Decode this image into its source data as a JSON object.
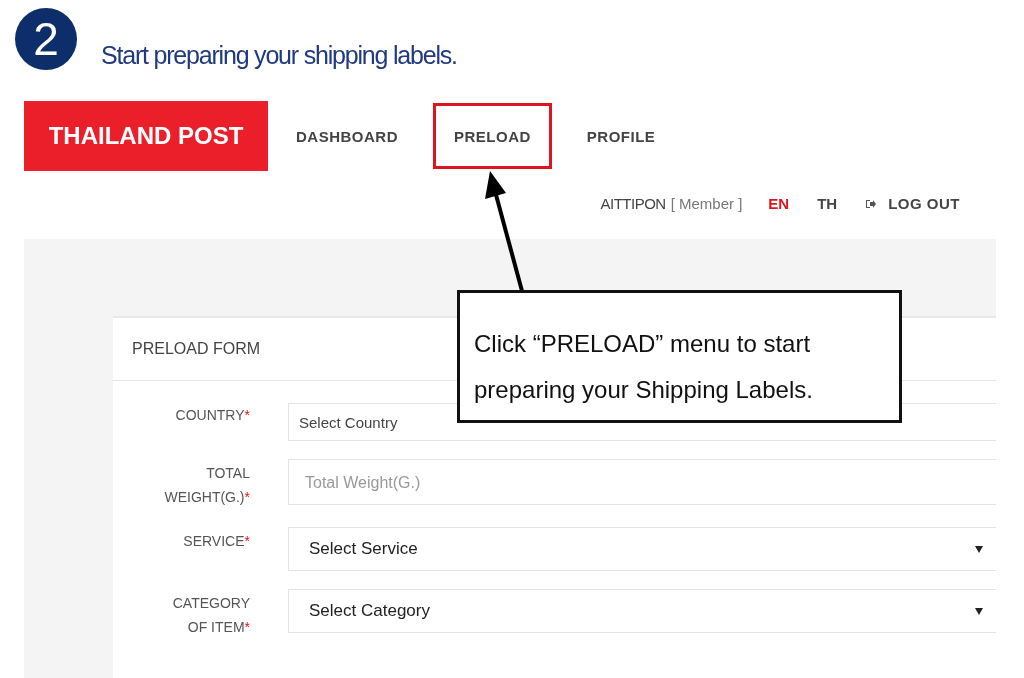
{
  "step": {
    "number": "2",
    "title": "Start preparing your shipping labels."
  },
  "header": {
    "logo": "THAILAND POST",
    "nav": [
      {
        "label": "DASHBOARD",
        "highlighted": false
      },
      {
        "label": "PRELOAD",
        "highlighted": true
      },
      {
        "label": "PROFILE",
        "highlighted": false
      }
    ],
    "user": {
      "name": "AITTIPON",
      "role": "[ Member ]"
    },
    "languages": [
      {
        "label": "EN",
        "selected": true
      },
      {
        "label": "TH",
        "selected": false
      }
    ],
    "logout": "LOG OUT"
  },
  "form": {
    "title": "PRELOAD FORM",
    "fields": [
      {
        "label": "COUNTRY",
        "required_mark": "*",
        "kind": "select",
        "value": "Select Country",
        "dropdown_arrow": false
      },
      {
        "label": "TOTAL WEIGHT(G.)",
        "required_mark": "*",
        "kind": "input",
        "placeholder": "Total Weight(G.)"
      },
      {
        "label": "SERVICE",
        "required_mark": "*",
        "kind": "select",
        "value": "Select Service",
        "dropdown_arrow": true
      },
      {
        "label": "CATEGORY OF ITEM",
        "required_mark": "*",
        "kind": "select",
        "value": "Select Category",
        "dropdown_arrow": true
      }
    ]
  },
  "callout": {
    "text": "Click “PRELOAD” menu to start preparing your Shipping Labels."
  }
}
